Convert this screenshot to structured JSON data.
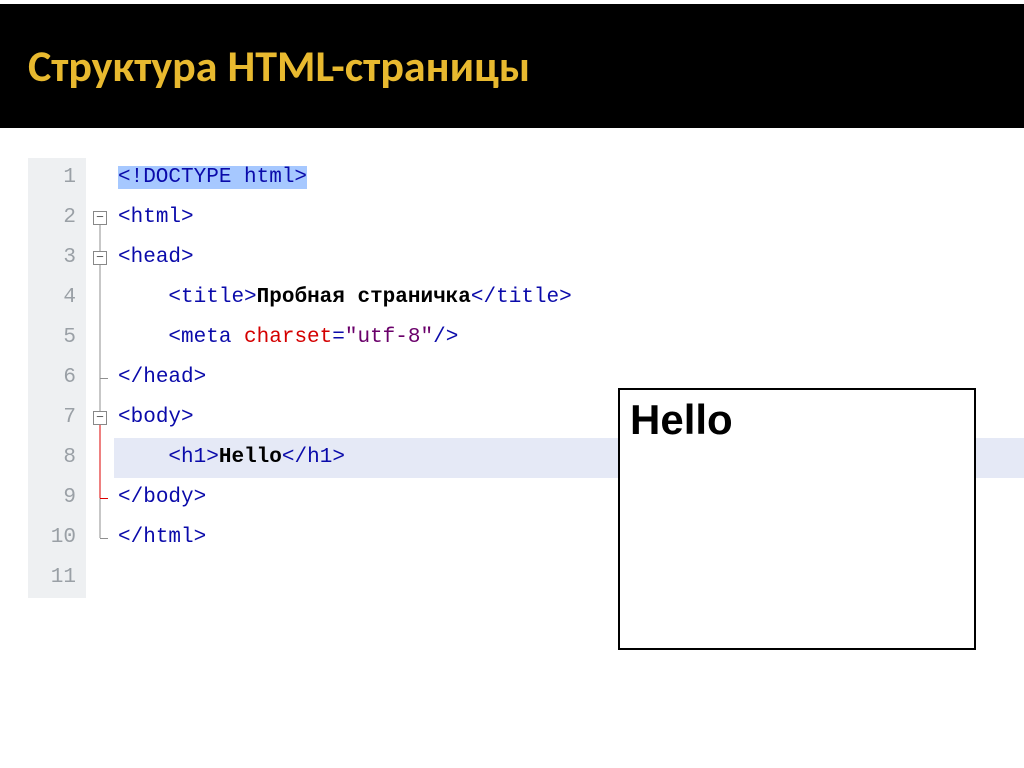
{
  "slide": {
    "title": "Структура HTML-страницы"
  },
  "editor": {
    "line_numbers": [
      "1",
      "2",
      "3",
      "4",
      "5",
      "6",
      "7",
      "8",
      "9",
      "10",
      "11"
    ],
    "fold_minus": "−",
    "code": {
      "l1_doctype": "<!DOCTYPE html>",
      "l2_open": "<",
      "l2_tag": "html",
      "l2_close": ">",
      "l3_open": "<",
      "l3_tag": "head",
      "l3_close": ">",
      "l4_open": "<",
      "l4_tag": "title",
      "l4_close": ">",
      "l4_text": "Пробная страничка",
      "l4_copen": "</",
      "l4_ctag": "title",
      "l4_cclose": ">",
      "l5_open": "<",
      "l5_tag": "meta ",
      "l5_attr": "charset",
      "l5_eq": "=",
      "l5_val": "\"utf-8\"",
      "l5_close": "/>",
      "l6_open": "</",
      "l6_tag": "head",
      "l6_close": ">",
      "l7_open": "<",
      "l7_tag": "body",
      "l7_close": ">",
      "l8_open": "<",
      "l8_tag": "h1",
      "l8_close": ">",
      "l8_text": "Hello",
      "l8_copen": "</",
      "l8_ctag": "h1",
      "l8_cclose": ">",
      "l9_open": "</",
      "l9_tag": "body",
      "l9_close": ">",
      "l10_open": "</",
      "l10_tag": "html",
      "l10_close": ">"
    }
  },
  "preview": {
    "heading": "Hello"
  }
}
